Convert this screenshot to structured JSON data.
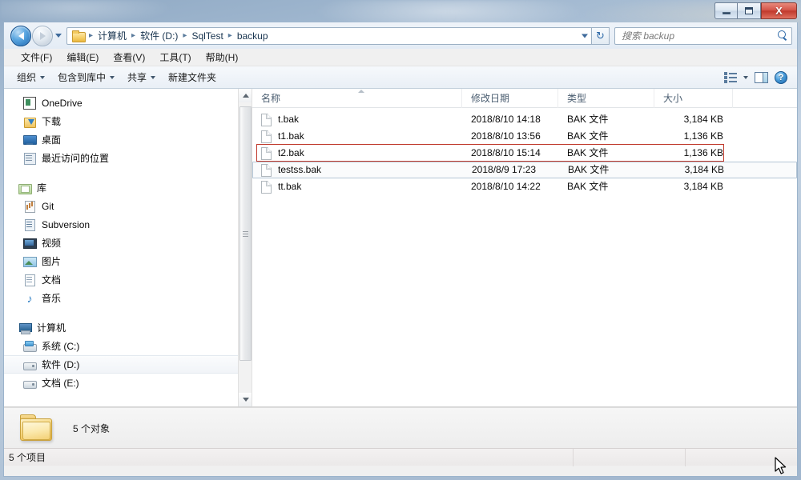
{
  "window": {
    "title": "backup",
    "controls": {
      "minimize_label": "最小化",
      "maximize_label": "最大化",
      "close_label": "X"
    }
  },
  "address_bar": {
    "back_tooltip": "后退",
    "forward_tooltip": "前进",
    "history_tooltip": "最近访问的位置",
    "folder_icon": "folder-icon",
    "breadcrumb": [
      "计算机",
      "软件 (D:)",
      "SqlTest",
      "backup"
    ],
    "separator": "▸",
    "refresh_label": "↻"
  },
  "search": {
    "placeholder": "搜索 backup",
    "icon": "search-icon"
  },
  "menubar": {
    "items": [
      {
        "label": "文件(F)"
      },
      {
        "label": "编辑(E)"
      },
      {
        "label": "查看(V)"
      },
      {
        "label": "工具(T)"
      },
      {
        "label": "帮助(H)"
      }
    ]
  },
  "toolbar": {
    "items": [
      {
        "label": "组织",
        "has_caret": true
      },
      {
        "label": "包含到库中",
        "has_caret": true
      },
      {
        "label": "共享",
        "has_caret": true
      },
      {
        "label": "新建文件夹",
        "has_caret": false
      }
    ],
    "view_icon": "view-mode-icon",
    "view_caret_icon": "chevron-down-icon",
    "preview_pane_icon": "preview-pane-icon",
    "help_icon": "help-icon",
    "help_glyph": "?"
  },
  "sidebar": {
    "items": [
      {
        "label": "OneDrive",
        "icon": "onedrive-icon",
        "level": 1,
        "selected": false,
        "gap": false
      },
      {
        "label": "下载",
        "icon": "downloads-icon",
        "level": 1,
        "selected": false,
        "gap": false
      },
      {
        "label": "桌面",
        "icon": "desktop-icon",
        "level": 1,
        "selected": false,
        "gap": false
      },
      {
        "label": "最近访问的位置",
        "icon": "recent-places-icon",
        "level": 1,
        "selected": false,
        "gap": false
      },
      {
        "label": "库",
        "icon": "library-icon",
        "level": 0,
        "selected": false,
        "gap": true
      },
      {
        "label": "Git",
        "icon": "git-icon",
        "level": 1,
        "selected": false,
        "gap": false
      },
      {
        "label": "Subversion",
        "icon": "subversion-icon",
        "level": 1,
        "selected": false,
        "gap": false
      },
      {
        "label": "视频",
        "icon": "video-icon",
        "level": 1,
        "selected": false,
        "gap": false
      },
      {
        "label": "图片",
        "icon": "pictures-icon",
        "level": 1,
        "selected": false,
        "gap": false
      },
      {
        "label": "文档",
        "icon": "documents-icon",
        "level": 1,
        "selected": false,
        "gap": false
      },
      {
        "label": "音乐",
        "icon": "music-icon",
        "level": 1,
        "selected": false,
        "gap": false
      },
      {
        "label": "计算机",
        "icon": "computer-icon",
        "level": 0,
        "selected": false,
        "gap": true
      },
      {
        "label": "系统 (C:)",
        "icon": "system-drive-icon",
        "level": 1,
        "selected": false,
        "gap": false
      },
      {
        "label": "软件 (D:)",
        "icon": "drive-icon",
        "level": 1,
        "selected": true,
        "gap": false
      },
      {
        "label": "文档 (E:)",
        "icon": "drive-icon",
        "level": 1,
        "selected": false,
        "gap": false
      }
    ],
    "scrollbar": {
      "up_icon": "scroll-up-icon",
      "down_icon": "scroll-down-icon"
    }
  },
  "file_list": {
    "columns": [
      {
        "key": "name",
        "label": "名称"
      },
      {
        "key": "date",
        "label": "修改日期"
      },
      {
        "key": "type",
        "label": "类型"
      },
      {
        "key": "size",
        "label": "大小"
      }
    ],
    "sort_column": "名称",
    "sort_direction": "asc",
    "rows": [
      {
        "name": "t.bak",
        "date": "2018/8/10 14:18",
        "type": "BAK 文件",
        "size": "3,184 KB",
        "selected": false,
        "annotated": false
      },
      {
        "name": "t1.bak",
        "date": "2018/8/10 13:56",
        "type": "BAK 文件",
        "size": "1,136 KB",
        "selected": false,
        "annotated": false
      },
      {
        "name": "t2.bak",
        "date": "2018/8/10 15:14",
        "type": "BAK 文件",
        "size": "1,136 KB",
        "selected": false,
        "annotated": true
      },
      {
        "name": "testss.bak",
        "date": "2018/8/9 17:23",
        "type": "BAK 文件",
        "size": "3,184 KB",
        "selected": true,
        "annotated": false
      },
      {
        "name": "tt.bak",
        "date": "2018/8/10 14:22",
        "type": "BAK 文件",
        "size": "3,184 KB",
        "selected": false,
        "annotated": false
      }
    ]
  },
  "annotation": {
    "color": "#c0392b",
    "target": "t2.bak"
  },
  "details_pane": {
    "icon": "folder-large-icon",
    "text": "5 个对象"
  },
  "status_bar": {
    "text": "5 个项目"
  },
  "colors": {
    "accent": "#2f6aa8",
    "annotation_red": "#c0392b",
    "selection_border": "#b5c6d6",
    "close_button": "#c0392c"
  }
}
